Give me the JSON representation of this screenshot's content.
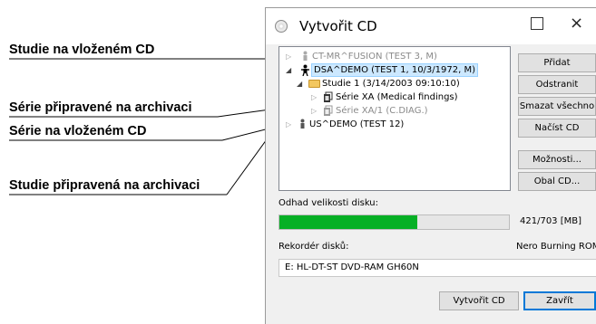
{
  "callouts": {
    "loaded_study": "Studie na vloženém CD",
    "series_prepared": "Série připravené na archivaci",
    "loaded_series": "Série na vloženém CD",
    "study_prepared": "Studie připravená na archivaci"
  },
  "window": {
    "title": "Vytvořit CD",
    "minimize_label": "□",
    "close_label": "×"
  },
  "tree": [
    {
      "label": "CT-MR^FUSION (TEST 3, M)",
      "state": "dim"
    },
    {
      "label": "DSA^DEMO (TEST 1, 10/3/1972, M)",
      "state": "selected"
    },
    {
      "label": "Studie 1 (3/14/2003 09:10:10)",
      "state": "normal"
    },
    {
      "label": "Série XA (Medical findings)",
      "state": "normal"
    },
    {
      "label": "Série XA/1 (C.DIAG.)",
      "state": "dim"
    },
    {
      "label": "US^DEMO (TEST 12)",
      "state": "normal"
    }
  ],
  "buttons": {
    "add": "Přidat",
    "remove": "Odstranit",
    "remove_all": "Smazat všechno",
    "load_cd": "Načíst CD",
    "options": "Možnosti...",
    "cover": "Obal CD...",
    "create_cd": "Vytvořit CD",
    "close": "Zavřít"
  },
  "disk": {
    "estimate_label": "Odhad velikosti disku:",
    "used_mb": 421,
    "total_mb": 703,
    "size_text": "421/703 [MB]",
    "fill_color": "#06b025"
  },
  "recorder": {
    "label": "Rekordér disků:",
    "engine": "Nero Burning ROM",
    "selected_device": "E: HL-DT-ST DVD-RAM GH60N"
  }
}
